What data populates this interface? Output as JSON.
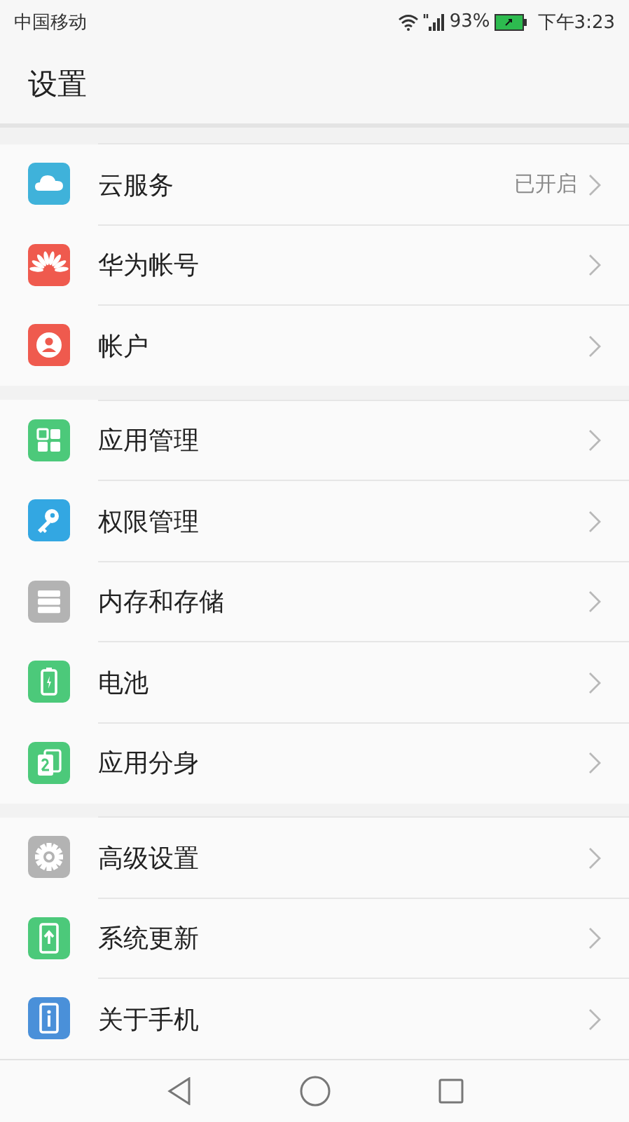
{
  "status_bar": {
    "carrier": "中国移动",
    "battery": "93%",
    "time": "下午3:23"
  },
  "header": {
    "title": "设置"
  },
  "groups": [
    {
      "items": [
        {
          "label": "云服务",
          "value": "已开启"
        },
        {
          "label": "华为帐号"
        },
        {
          "label": "帐户"
        }
      ]
    },
    {
      "items": [
        {
          "label": "应用管理"
        },
        {
          "label": "权限管理"
        },
        {
          "label": "内存和存储"
        },
        {
          "label": "电池"
        },
        {
          "label": "应用分身"
        }
      ]
    },
    {
      "items": [
        {
          "label": "高级设置"
        },
        {
          "label": "系统更新"
        },
        {
          "label": "关于手机"
        }
      ]
    }
  ]
}
